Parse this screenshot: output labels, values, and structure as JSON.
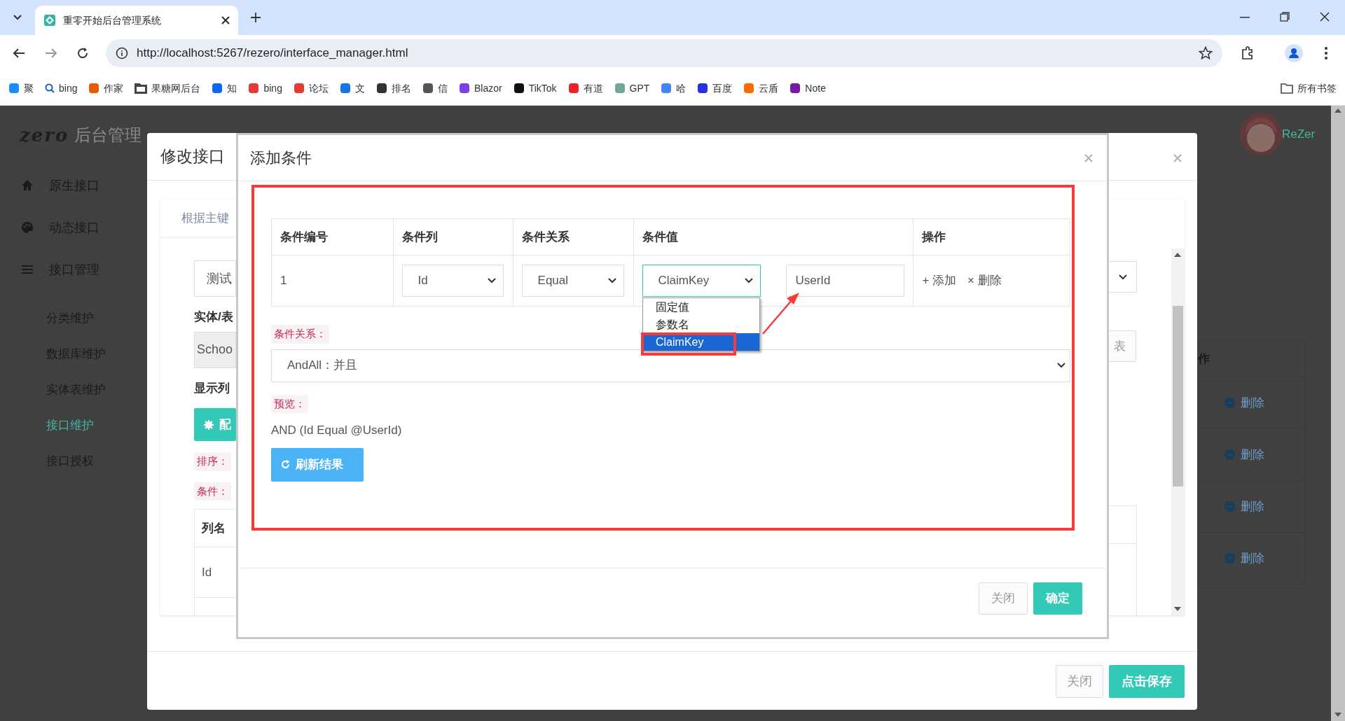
{
  "browser": {
    "tabs": [
      {
        "title": "重零开始后台管理系统",
        "selected": true
      }
    ],
    "url": "http://localhost:5267/rezero/interface_manager.html",
    "bookmarks": [
      {
        "label": "聚",
        "kind": "site",
        "color": "#1a8cff"
      },
      {
        "label": "bing",
        "kind": "search",
        "color": "#1565c0"
      },
      {
        "label": "作家",
        "kind": "site",
        "color": "#e65c00"
      },
      {
        "label": "果糖网后台",
        "kind": "folder",
        "color": "#444444"
      },
      {
        "label": "知",
        "kind": "site",
        "color": "#0a66ff"
      },
      {
        "label": "bing",
        "kind": "site",
        "color": "#e53935"
      },
      {
        "label": "论坛",
        "kind": "site",
        "color": "#e53935"
      },
      {
        "label": "文",
        "kind": "site",
        "color": "#1a73e8"
      },
      {
        "label": "排名",
        "kind": "site",
        "color": "#333333"
      },
      {
        "label": "信",
        "kind": "site",
        "color": "#555555"
      },
      {
        "label": "Blazor",
        "kind": "site",
        "color": "#7b3fe4"
      },
      {
        "label": "TikTok",
        "kind": "site",
        "color": "#111111"
      },
      {
        "label": "有道",
        "kind": "site",
        "color": "#e8242b"
      },
      {
        "label": "GPT",
        "kind": "site",
        "color": "#6fa89a"
      },
      {
        "label": "哈",
        "kind": "site",
        "color": "#4285f4"
      },
      {
        "label": "百度",
        "kind": "site",
        "color": "#2932e1"
      },
      {
        "label": "云盾",
        "kind": "site",
        "color": "#ff6a00"
      },
      {
        "label": "Note",
        "kind": "site",
        "color": "#7719aa"
      }
    ],
    "all_bookmarks": "所有书签"
  },
  "app": {
    "logo": "zero",
    "title": "后台管理",
    "sidebar": [
      {
        "label": "原生接口",
        "kind": "group",
        "selected": false
      },
      {
        "label": "动态接口",
        "kind": "group",
        "selected": false
      },
      {
        "label": "接口管理",
        "kind": "group",
        "selected": false
      },
      {
        "label": "分类维护",
        "kind": "sub",
        "selected": false
      },
      {
        "label": "数据库维护",
        "kind": "sub",
        "selected": false
      },
      {
        "label": "实体表维护",
        "kind": "sub",
        "selected": false
      },
      {
        "label": "接口维护",
        "kind": "sub",
        "selected": true
      },
      {
        "label": "接口授权",
        "kind": "sub",
        "selected": false
      }
    ],
    "user": "ReZer",
    "table": {
      "header": "作",
      "rows": [
        {
          "action": "删除"
        },
        {
          "action": "删除"
        },
        {
          "action": "删除"
        },
        {
          "action": "删除"
        }
      ]
    }
  },
  "edit_modal": {
    "title": "修改接口",
    "tab": "根据主键",
    "menu_value": "测试",
    "entity_label": "实体/表",
    "entity_value": "Schoo",
    "columns_label": "显示列",
    "config_button": "配",
    "sort_label": "排序：",
    "condition_label": "条件：",
    "table_header": "列名",
    "table_cell": "Id",
    "side_button": "表",
    "buttons": [
      "关闭",
      "点击保存"
    ]
  },
  "condition_modal": {
    "title": "添加条件",
    "columns": [
      "条件编号",
      "条件列",
      "条件关系",
      "条件值",
      "操作"
    ],
    "rows": [
      {
        "number": "1",
        "column": "Id",
        "relation": "Equal",
        "value_type": "ClaimKey",
        "value": "UserId",
        "add": "+ 添加",
        "delete": "× 删除"
      }
    ],
    "dropdown": [
      {
        "label": "固定值",
        "selected": false
      },
      {
        "label": "参数名",
        "selected": false
      },
      {
        "label": "ClaimKey",
        "selected": true
      }
    ],
    "relation_label": "条件关系：",
    "relation_value": "AndAll：并且",
    "preview_label": "预览：",
    "preview": "AND (Id Equal @UserId)",
    "refresh_button": "刷新结果",
    "buttons": [
      "关闭",
      "确定"
    ]
  }
}
